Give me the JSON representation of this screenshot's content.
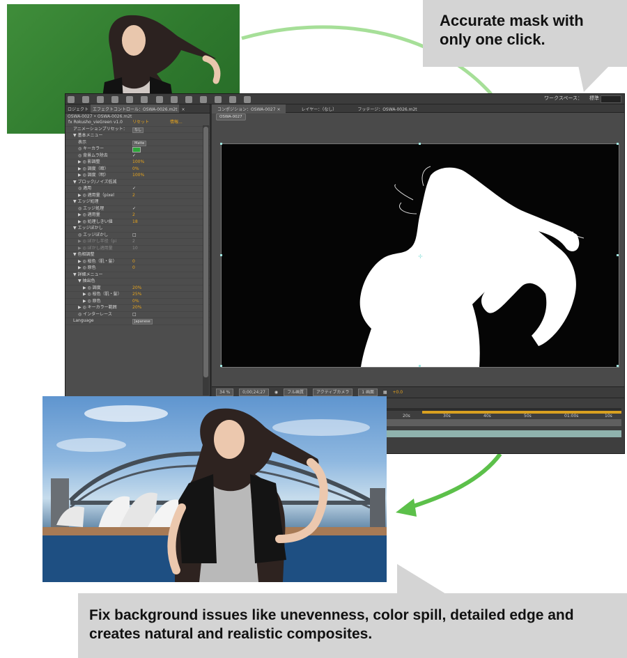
{
  "callouts": {
    "top": "Accurate mask with\nonly one click.",
    "bottom": "Fix background issues like unevenness, color spill, detailed edge and creates natural and realistic composites."
  },
  "colors": {
    "arrow_green": "#5cc04a",
    "callout_gray": "#d4d4d4",
    "value_orange": "#e7a41c",
    "handle_cyan": "#9fe6e0"
  },
  "ae": {
    "workspace_label": "ワークスペース：",
    "workspace_value": "標準",
    "effect_panel": {
      "tabs": [
        "ロジェクト",
        "エフェクトコントロール：OSWA-0026.m2t",
        "×"
      ],
      "subtitle": "OSWA-0027 • OSWA-0026.m2t",
      "rows": [
        {
          "indent": 0,
          "label": "fx  Rokusho_vieGreen v1.0",
          "value": "リセット",
          "value2": "情報..."
        },
        {
          "indent": 1,
          "label": "アニメーションプリセット：",
          "dropdown": "なし"
        },
        {
          "indent": 1,
          "label": "▼ 基本メニュー"
        },
        {
          "indent": 2,
          "label": "表示",
          "dropdown": "Matte"
        },
        {
          "indent": 2,
          "label": "◎ キーカラー",
          "swatch": true
        },
        {
          "indent": 2,
          "label": "◎ 背景ムラ除去",
          "value": "✓",
          "white": true
        },
        {
          "indent": 2,
          "label": "▶ ◎ 影調整",
          "value": "100%"
        },
        {
          "indent": 2,
          "label": "▶ ◎ 調度（暗）",
          "value": "0%"
        },
        {
          "indent": 2,
          "label": "▶ ◎ 調度（明）",
          "value": "100%"
        },
        {
          "indent": 1,
          "label": "▼ ブロック/ノイズ低減"
        },
        {
          "indent": 2,
          "label": "◎ 適用",
          "value": "✓",
          "white": true
        },
        {
          "indent": 2,
          "label": "▶ ◎ 適用量（pixel",
          "value": "2"
        },
        {
          "indent": 1,
          "label": "▼ エッジ処理"
        },
        {
          "indent": 2,
          "label": "◎ エッジ処理",
          "value": "✓",
          "white": true
        },
        {
          "indent": 2,
          "label": "▶ ◎ 適用量",
          "value": "2"
        },
        {
          "indent": 2,
          "label": "▶ ◎ 処理しきい値",
          "value": "18"
        },
        {
          "indent": 1,
          "label": "▼ エッジぼかし"
        },
        {
          "indent": 2,
          "label": "◎ エッジぼかし",
          "value": "□",
          "white": true
        },
        {
          "indent": 2,
          "label": "▶ ◎ ぼかし半径（pi",
          "value": "2",
          "gray": true,
          "disabled": true
        },
        {
          "indent": 2,
          "label": "▶ ◎ ぼかし適用量",
          "value": "10",
          "gray": true,
          "disabled": true
        },
        {
          "indent": 1,
          "label": "▼ 色相調整"
        },
        {
          "indent": 2,
          "label": "▶ ◎ 桜色（肌・髪）",
          "value": "0"
        },
        {
          "indent": 2,
          "label": "▶ ◎ 原色",
          "value": "0"
        },
        {
          "indent": 1,
          "label": "▼ 詳細メニュー"
        },
        {
          "indent": 2,
          "label": "▼ 抽出色"
        },
        {
          "indent": 3,
          "label": "▶ ◎ 調度",
          "value": "20%"
        },
        {
          "indent": 3,
          "label": "▶ ◎ 桜色（肌・髪）",
          "value": "25%"
        },
        {
          "indent": 3,
          "label": "▶ ◎ 原色",
          "value": "0%"
        },
        {
          "indent": 2,
          "label": "▶ ◎ キーカラー範囲",
          "value": "20%"
        },
        {
          "indent": 2,
          "label": "◎ インターレース",
          "value": "□",
          "white": true
        },
        {
          "indent": 1,
          "label": "Language",
          "dropdown": "Japanese"
        }
      ]
    },
    "comp_panel": {
      "tabs": [
        "コンポジション：OSWA-0027 ×",
        "レイヤー：（なし）",
        "フッテージ：OSWA-0026.m2t"
      ],
      "chip": "OSWA-0027",
      "footer": {
        "zoom": "34 %",
        "timecode": "0;00;24;27",
        "resolution": "フル画質",
        "camera": "アクティブカメラ",
        "view": "1 画面",
        "offset": "+0.0"
      }
    },
    "timeline": {
      "ticks": [
        "20s",
        "30s",
        "40s",
        "50s",
        "01:00s",
        "10s"
      ]
    }
  }
}
